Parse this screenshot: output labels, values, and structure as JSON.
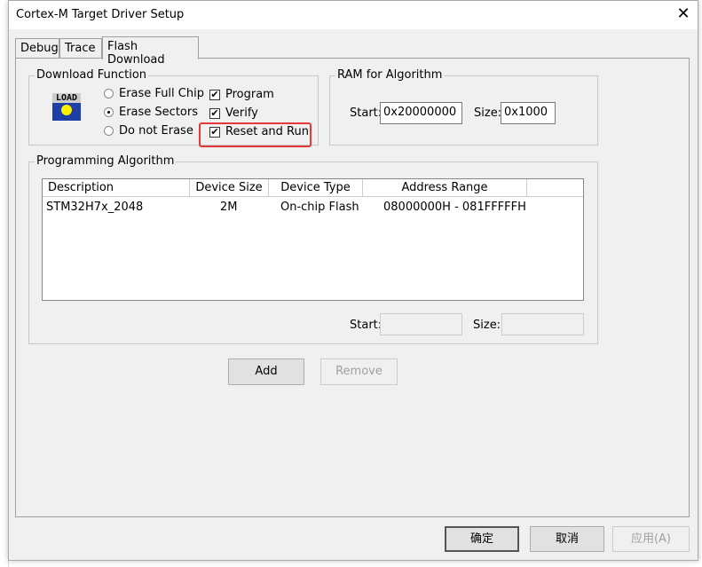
{
  "window": {
    "title": "Cortex-M Target Driver Setup",
    "close": "✕"
  },
  "tabs": [
    {
      "label": "Debug"
    },
    {
      "label": "Trace"
    },
    {
      "label": "Flash Download",
      "active": true
    }
  ],
  "download_function": {
    "label": "Download Function",
    "logo": "LOAD",
    "erase_options": [
      {
        "label": "Erase Full Chip",
        "selected": false
      },
      {
        "label": "Erase Sectors",
        "selected": true
      },
      {
        "label": "Do not Erase",
        "selected": false
      }
    ],
    "checks": [
      {
        "label": "Program",
        "checked": true
      },
      {
        "label": "Verify",
        "checked": true
      },
      {
        "label": "Reset and Run",
        "checked": true,
        "highlighted": true
      }
    ]
  },
  "ram": {
    "label": "RAM for Algorithm",
    "start_label": "Start:",
    "start": "0x20000000",
    "size_label": "Size:",
    "size": "0x1000"
  },
  "algorithm": {
    "label": "Programming Algorithm",
    "columns": [
      "Description",
      "Device Size",
      "Device Type",
      "Address Range"
    ],
    "rows": [
      {
        "description": "STM32H7x_2048",
        "size": "2M",
        "type": "On-chip Flash",
        "range": "08000000H - 081FFFFFH"
      }
    ],
    "start_label": "Start:",
    "start": "",
    "size_label": "Size:",
    "size": ""
  },
  "buttons": {
    "add": "Add",
    "remove": "Remove",
    "ok": "确定",
    "cancel": "取消",
    "apply": "应用(A)"
  },
  "colors": {
    "highlight": "#e53935"
  }
}
